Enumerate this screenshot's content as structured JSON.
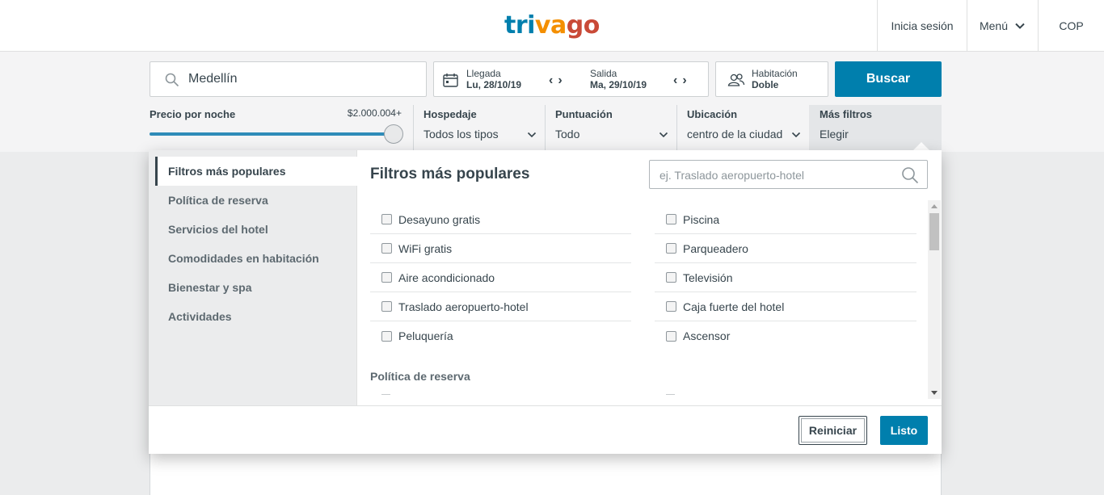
{
  "header": {
    "logo": {
      "part1": "tri",
      "part2": "va",
      "part3": "go"
    },
    "login": "Inicia sesión",
    "menu": "Menú",
    "currency": "COP"
  },
  "search": {
    "destination": "Medellín",
    "checkin_label": "Llegada",
    "checkin_value": "Lu, 28/10/19",
    "checkout_label": "Salida",
    "checkout_value": "Ma, 29/10/19",
    "room_label": "Habitación",
    "room_value": "Doble",
    "search_button": "Buscar"
  },
  "filters": {
    "price_label": "Precio por noche",
    "price_value": "$2.000.004+",
    "price_slider_fraction": 1.0,
    "lodging_label": "Hospedaje",
    "lodging_value": "Todos los tipos",
    "rating_label": "Puntuación",
    "rating_value": "Todo",
    "location_label": "Ubicación",
    "location_value": "centro de la ciudad",
    "more_label": "Más filtros",
    "more_value": "Elegir"
  },
  "panel": {
    "sidebar": [
      "Filtros más populares",
      "Política de reserva",
      "Servicios del hotel",
      "Comodidades en habitación",
      "Bienestar y spa",
      "Actividades"
    ],
    "title": "Filtros más populares",
    "search_placeholder": "ej. Traslado aeropuerto-hotel",
    "options_left": [
      "Desayuno gratis",
      "WiFi gratis",
      "Aire acondicionado",
      "Traslado aeropuerto-hotel",
      "Peluquería"
    ],
    "options_right": [
      "Piscina",
      "Parqueadero",
      "Televisión",
      "Caja fuerte del hotel",
      "Ascensor"
    ],
    "subheading": "Política de reserva",
    "reset_button": "Reiniciar",
    "done_button": "Listo"
  },
  "colors": {
    "brand_blue": "#007fad",
    "text": "#37454d"
  }
}
